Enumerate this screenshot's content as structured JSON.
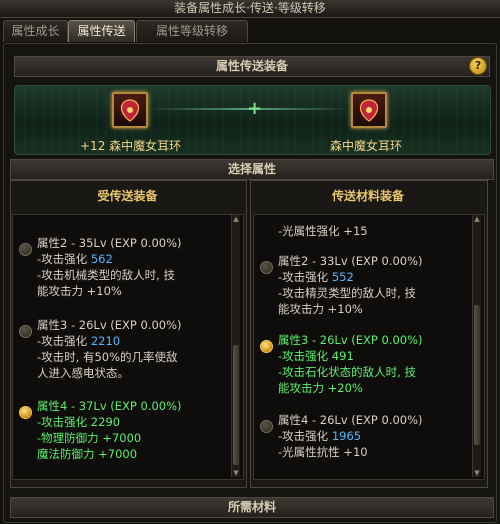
{
  "window": {
    "title": "装备属性成长·传送·等级转移"
  },
  "tabs": [
    {
      "label": "属性成长"
    },
    {
      "label": "属性传送"
    },
    {
      "label": "属性等级转移"
    }
  ],
  "transfer_section": {
    "header": "属性传送装备",
    "help_label": "?",
    "plus": "+",
    "source_item_name": "+12 森中魔女耳环",
    "target_item_name": "森中魔女耳环"
  },
  "select_section": {
    "header": "选择属性"
  },
  "left_column": {
    "header": "受传送装备",
    "entries": [
      {
        "selected": false,
        "lines": [
          {
            "text": "属性2 - 35Lv (EXP 0.00%)",
            "value": ""
          },
          {
            "text": "-攻击强化 ",
            "value": "562"
          },
          {
            "text": "-攻击机械类型的敌人时, 技",
            "value": ""
          },
          {
            "text": " 能攻击力 +10%",
            "value": ""
          }
        ]
      },
      {
        "selected": false,
        "lines": [
          {
            "text": "属性3 - 26Lv (EXP 0.00%)",
            "value": ""
          },
          {
            "text": "-攻击强化 ",
            "value": "2210"
          },
          {
            "text": "-攻击时, 有50%的几率使敌",
            "value": ""
          },
          {
            "text": " 人进入感电状态。",
            "value": ""
          }
        ]
      },
      {
        "selected": true,
        "lines": [
          {
            "text": "属性4 - 37Lv (EXP 0.00%)",
            "value": ""
          },
          {
            "text": "-攻击强化 2290",
            "value": ""
          },
          {
            "text": "-物理防御力 +7000",
            "value": ""
          },
          {
            "text": " 魔法防御力 +7000",
            "value": ""
          }
        ]
      }
    ]
  },
  "right_column": {
    "header": "传送材料装备",
    "top_line": "-光属性强化 +15",
    "entries": [
      {
        "selected": false,
        "lines": [
          {
            "text": "属性2 - 33Lv (EXP 0.00%)",
            "value": ""
          },
          {
            "text": "-攻击强化 ",
            "value": "552"
          },
          {
            "text": "-攻击精灵类型的敌人时, 技",
            "value": ""
          },
          {
            "text": " 能攻击力 +10%",
            "value": ""
          }
        ]
      },
      {
        "selected": true,
        "lines": [
          {
            "text": "属性3 - 26Lv (EXP 0.00%)",
            "value": ""
          },
          {
            "text": "-攻击强化 491",
            "value": ""
          },
          {
            "text": "-攻击石化状态的敌人时, 技",
            "value": ""
          },
          {
            "text": " 能攻击力 +20%",
            "value": ""
          }
        ]
      },
      {
        "selected": false,
        "lines": [
          {
            "text": "属性4 - 26Lv (EXP 0.00%)",
            "value": ""
          },
          {
            "text": "-攻击强化 ",
            "value": "1965"
          },
          {
            "text": "-光属性抗性 +10",
            "value": ""
          }
        ]
      }
    ]
  },
  "materials_section": {
    "header": "所需材料"
  },
  "colors": {
    "selected_text": "#5cf06c",
    "value_blue": "#55b7ff",
    "gold_header": "#e8c56b"
  }
}
